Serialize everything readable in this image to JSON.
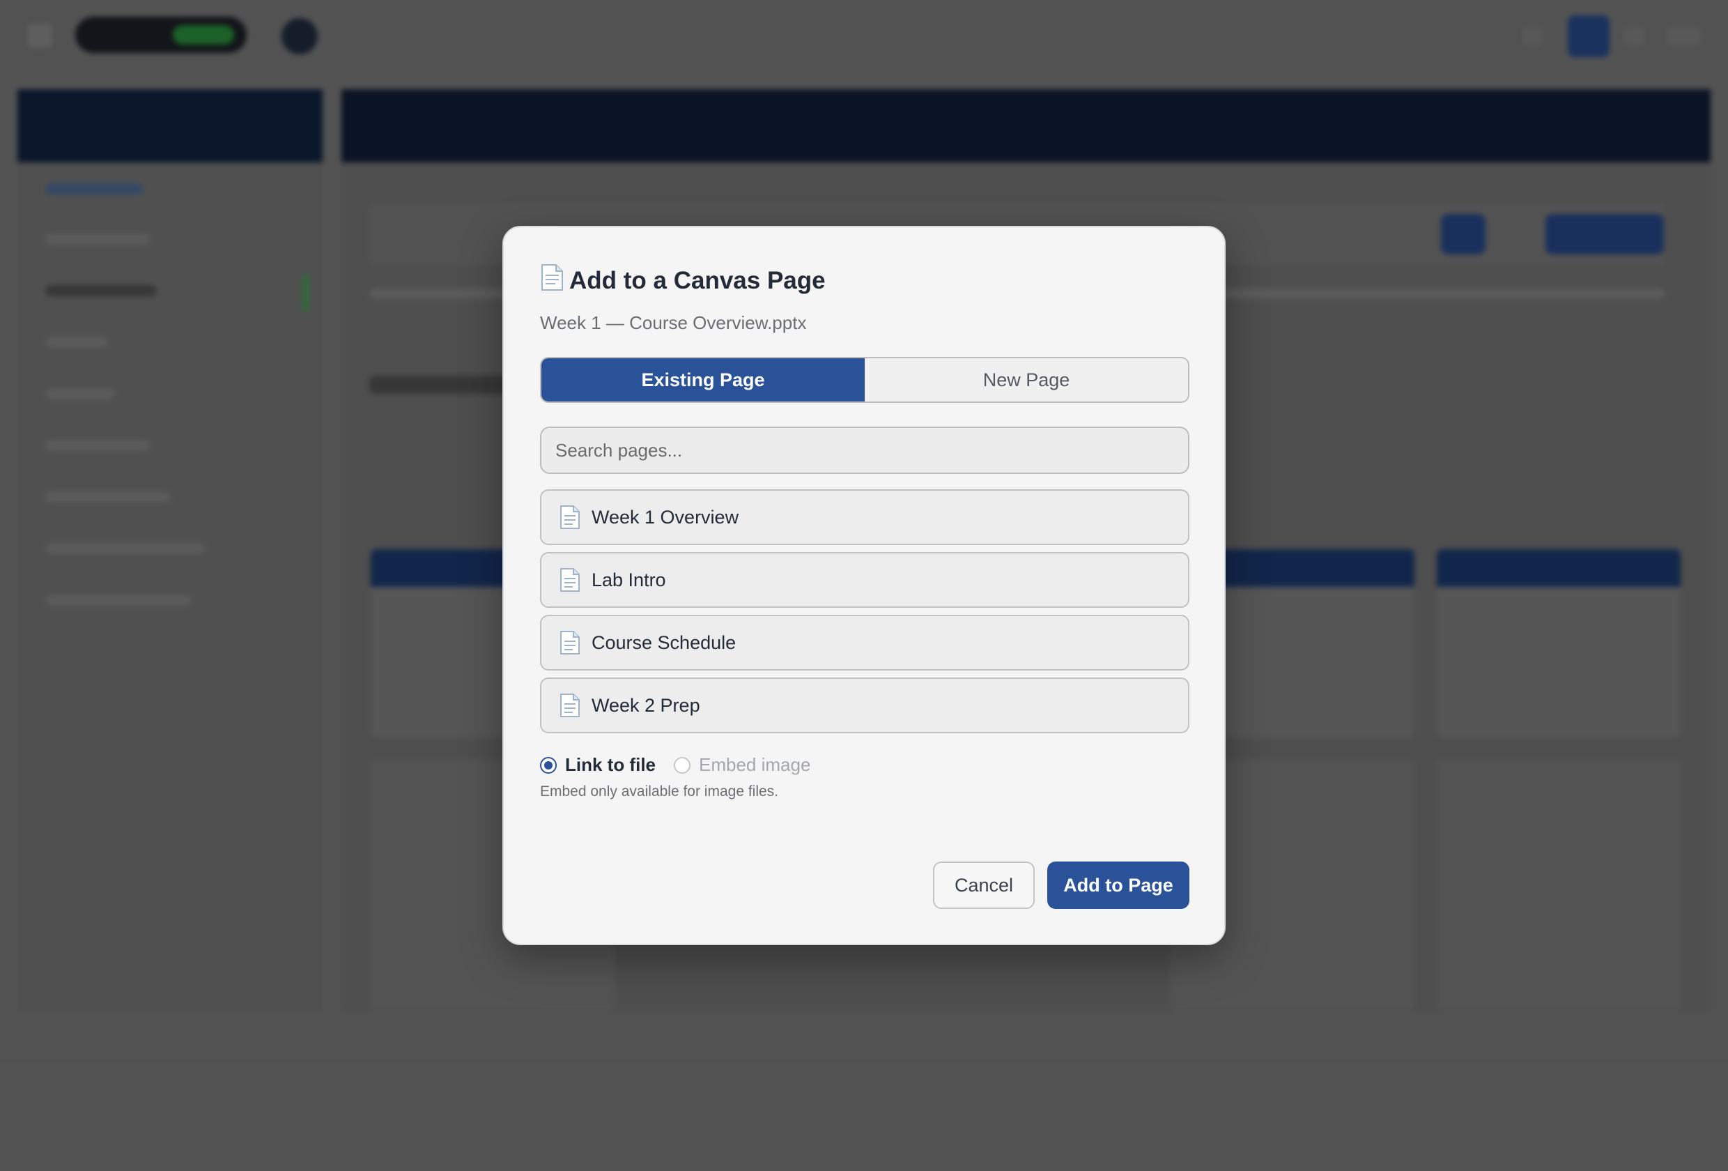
{
  "modal": {
    "title_icon": "document-icon",
    "title": "Add to a Canvas Page",
    "subtitle": "Week 1 — Course Overview.pptx",
    "tabs": [
      {
        "label": "Existing Page",
        "active": true
      },
      {
        "label": "New Page",
        "active": false
      }
    ],
    "search": {
      "placeholder": "Search pages...",
      "value": ""
    },
    "pages": [
      {
        "label": "Week 1 Overview",
        "icon": "document-icon"
      },
      {
        "label": "Lab Intro",
        "icon": "document-icon"
      },
      {
        "label": "Course Schedule",
        "icon": "document-icon"
      },
      {
        "label": "Week 2 Prep",
        "icon": "document-icon"
      }
    ],
    "options": {
      "link": {
        "label": "Link to file",
        "checked": true
      },
      "embed": {
        "label": "Embed image",
        "checked": false,
        "disabled": true
      }
    },
    "hint": "Embed only available for image files.",
    "cancel_label": "Cancel",
    "add_label": "Add to Page"
  },
  "colors": {
    "accent": "#2a5298",
    "modal_bg": "#f5f5f5",
    "backdrop": "#5a5a5a"
  }
}
